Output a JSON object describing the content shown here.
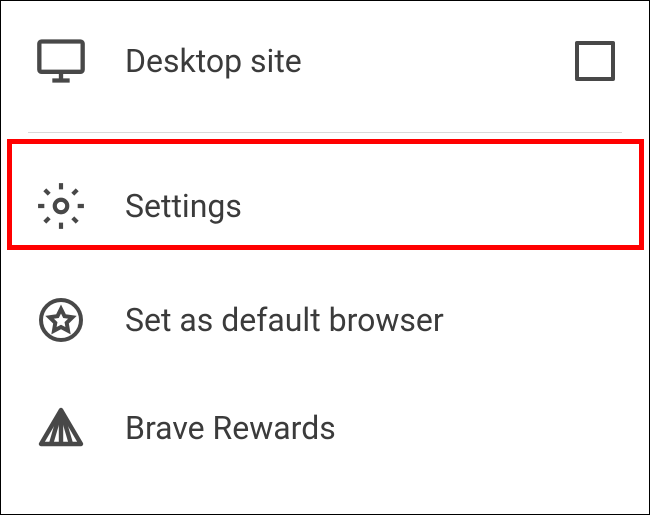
{
  "menu": {
    "desktop_site": {
      "label": "Desktop site",
      "checked": false
    },
    "settings": {
      "label": "Settings"
    },
    "default_browser": {
      "label": "Set as default browser"
    },
    "brave_rewards": {
      "label": "Brave Rewards"
    }
  },
  "annotation": {
    "highlighted_item": "settings"
  }
}
